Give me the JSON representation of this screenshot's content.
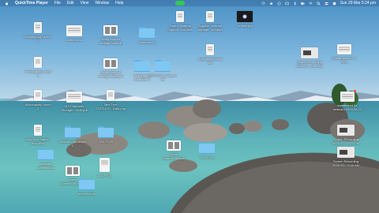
{
  "menubar": {
    "app_name": "QuickTime Player",
    "items": [
      "File",
      "Edit",
      "View",
      "Window",
      "Help"
    ],
    "clock": "Sun 29 Mar  5:24 pm"
  },
  "desktop_icons": [
    {
      "name": "wollongong-dinner-icon",
      "type": "doc",
      "label1": "Wollongong Dinner",
      "label2": "1"
    },
    {
      "name": "untitled-pod-icon",
      "type": "doc-landscape",
      "label1": "Untitled.pod",
      "label2": ""
    },
    {
      "name": "swing-tags-1-icon",
      "type": "pdf",
      "label1": "Swing tags for",
      "label2": "heritage caps.ai"
    },
    {
      "name": "windows-11-icon",
      "type": "folder",
      "label1": "Windows 11",
      "label2": ""
    },
    {
      "name": "tower-systems-icon",
      "type": "doc",
      "label1": "Tower Systems",
      "label2": "Support...invoices"
    },
    {
      "name": "supplier-contract-icon",
      "type": "doc",
      "label1": "Supplier contract",
      "label2": "manage...tsfl.docx"
    },
    {
      "name": "senses-jpg-icon",
      "type": "dark",
      "label1": "senses.jpg",
      "label2": ""
    },
    {
      "name": "wollongong-lunch-1-icon",
      "type": "doc",
      "label1": "Wollongong Lunch",
      "label2": "1"
    },
    {
      "name": "swing-tags-2-icon",
      "type": "pdf",
      "label1": "Swing tags for",
      "label2": "heritage caps.pdf"
    },
    {
      "name": "wollongong-breakfast-icon",
      "type": "folder",
      "label1": "Wollongong",
      "label2": "Breakfast 1"
    },
    {
      "name": "stat1070-icon",
      "type": "folder",
      "label1": "STAT1070_Data_Fi",
      "label2": "les"
    },
    {
      "name": "supplier-directory-icon",
      "type": "doc",
      "label1": "SupplierDirectory",
      "label2": "csv"
    },
    {
      "name": "screen-recording-1-icon",
      "type": "rec",
      "label1": "Screen Recording",
      "label2": "2025-10-...pm.mov"
    },
    {
      "name": "scatter-plot-icon",
      "type": "doc-wide",
      "label1": "Scatter plot LoC +",
      "label2": "GSE"
    },
    {
      "name": "wollongong-lunch-2-icon",
      "type": "doc",
      "label1": "Wollongong Lunch",
      "label2": "2"
    },
    {
      "name": "via-character-icon",
      "type": "doc-landscape",
      "label1": "VIA Character",
      "label2": "Strength...Nule.pdf"
    },
    {
      "name": "take-test-icon",
      "type": "doc",
      "label1": "Take Test:",
      "label2": "STAT1070...Data.png"
    },
    {
      "name": "screenshot-1-icon",
      "type": "doc-wide",
      "label1": "screenshot for",
      "label2": "webcam 2025-08-13"
    },
    {
      "name": "screen-recording-2-icon",
      "type": "rec",
      "label1": "Screen Recording",
      "label2": "2025-10-...2.10 PM"
    },
    {
      "name": "woy-woy-station-icon",
      "type": "doc",
      "label1": "Woy Woy Station,",
      "label2": "Woy Woy"
    },
    {
      "name": "webcam-4th-march-icon",
      "type": "folder",
      "label1": "Webcam 4th March",
      "label2": "1"
    },
    {
      "name": "tax-fy21-icon",
      "type": "folder",
      "label1": "TAX FY21",
      "label2": ""
    },
    {
      "name": "week-commencing-1-icon",
      "type": "pdf",
      "label1": "Week",
      "label2": "Comme...March"
    },
    {
      "name": "tax-fy22-icon",
      "type": "folder",
      "label1": "TAX FY22",
      "label2": ""
    },
    {
      "name": "screen-recording-3-icon",
      "type": "rec",
      "label1": "Screen Recording",
      "label2": "2025-10-...3.40 AM"
    },
    {
      "name": "webcam-screenshots-icon",
      "type": "folder",
      "label1": "webcam",
      "label2": "screenshots"
    },
    {
      "name": "week-commencing-2-icon",
      "type": "pdf",
      "label1": "Week",
      "label2": "Comme...th March"
    },
    {
      "name": "tax-fy23-icon",
      "type": "doc-tall",
      "label1": "TAX FY23",
      "label2": ""
    },
    {
      "name": "screenshots-icon",
      "type": "folder",
      "label1": "screenshots",
      "label2": ""
    }
  ]
}
